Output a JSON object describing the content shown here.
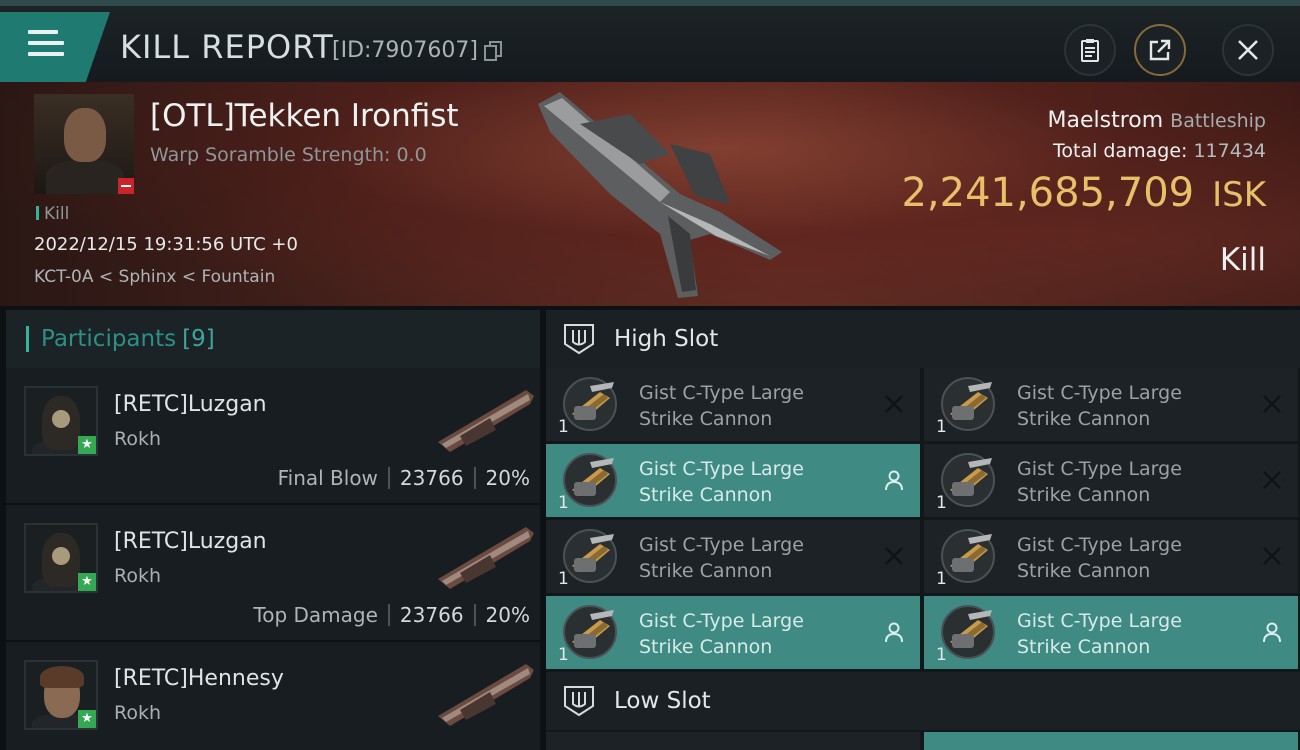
{
  "header": {
    "title": "KILL REPORT",
    "report_id": "[ID:7907607]",
    "menu_icon": "hamburger-menu-icon",
    "buttons": [
      "clipboard-icon",
      "share-icon",
      "close-icon"
    ],
    "accent_color": "#1f7a72"
  },
  "victim": {
    "name": "[OTL]Tekken Ironfist",
    "warp_scramble": "Warp Soramble Strength: 0.0",
    "tag": "Kill",
    "datetime": "2022/12/15 19:31:56 UTC +0",
    "location": "KCT-0A < Sphinx < Fountain",
    "ship_name": "Maelstrom",
    "ship_class": "Battleship",
    "total_damage_label": "Total damage:",
    "total_damage": "117434",
    "isk_value": "2,241,685,709",
    "isk_unit": "ISK",
    "result": "Kill"
  },
  "participants": {
    "label": "Participants",
    "count": "[9]",
    "rows": [
      {
        "name": "[RETC]Luzgan",
        "ship": "Rokh",
        "role": "Final Blow",
        "damage": "23766",
        "percent": "20%"
      },
      {
        "name": "[RETC]Luzgan",
        "ship": "Rokh",
        "role": "Top Damage",
        "damage": "23766",
        "percent": "20%"
      },
      {
        "name": "[RETC]Hennesy",
        "ship": "Rokh",
        "role": "",
        "damage": "",
        "percent": ""
      }
    ]
  },
  "slots": {
    "high_label": "High Slot",
    "low_label": "Low Slot",
    "modules": [
      {
        "line1": "Gist C-Type Large",
        "line2": "Strike Cannon",
        "qty": "1",
        "state": "destroyed"
      },
      {
        "line1": "Gist C-Type Large",
        "line2": "Strike Cannon",
        "qty": "1",
        "state": "destroyed"
      },
      {
        "line1": "Gist C-Type Large",
        "line2": "Strike Cannon",
        "qty": "1",
        "state": "dropped"
      },
      {
        "line1": "Gist C-Type Large",
        "line2": "Strike Cannon",
        "qty": "1",
        "state": "destroyed"
      },
      {
        "line1": "Gist C-Type Large",
        "line2": "Strike Cannon",
        "qty": "1",
        "state": "destroyed"
      },
      {
        "line1": "Gist C-Type Large",
        "line2": "Strike Cannon",
        "qty": "1",
        "state": "destroyed"
      },
      {
        "line1": "Gist C-Type Large",
        "line2": "Strike Cannon",
        "qty": "1",
        "state": "dropped"
      },
      {
        "line1": "Gist C-Type Large",
        "line2": "Strike Cannon",
        "qty": "1",
        "state": "dropped"
      }
    ]
  },
  "colors": {
    "isk": "#e9c06a",
    "dropped_bg": "#3f8a82",
    "destroyed_bg": "#1c2226"
  }
}
